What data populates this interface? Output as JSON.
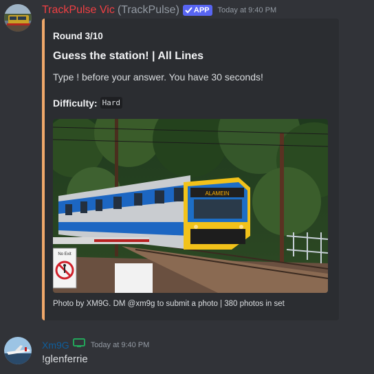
{
  "messages": [
    {
      "username": "TrackPulse Vic",
      "handle": "(TrackPulse)",
      "badge": "APP",
      "timestamp": "Today at 9:40 PM",
      "name_color": "#f23f43",
      "embed": {
        "accent_color": "#f0a86a",
        "round": "Round 3/10",
        "title": "Guess the station! | All Lines",
        "description": "Type ! before your answer. You have 30 seconds!",
        "difficulty_label": "Difficulty:",
        "difficulty_value": "Hard",
        "image": {
          "destination_sign": "ALAMEIN",
          "no_exit_sign": "No Exit"
        },
        "footer": "Photo by XM9G. DM @xm9g to submit a photo | 380 photos in set"
      }
    },
    {
      "username": "Xm9G",
      "status_icon": "monitor-icon",
      "timestamp": "Today at 9:40 PM",
      "name_color": "#0f5e9c",
      "content": "!glenferrie"
    }
  ]
}
